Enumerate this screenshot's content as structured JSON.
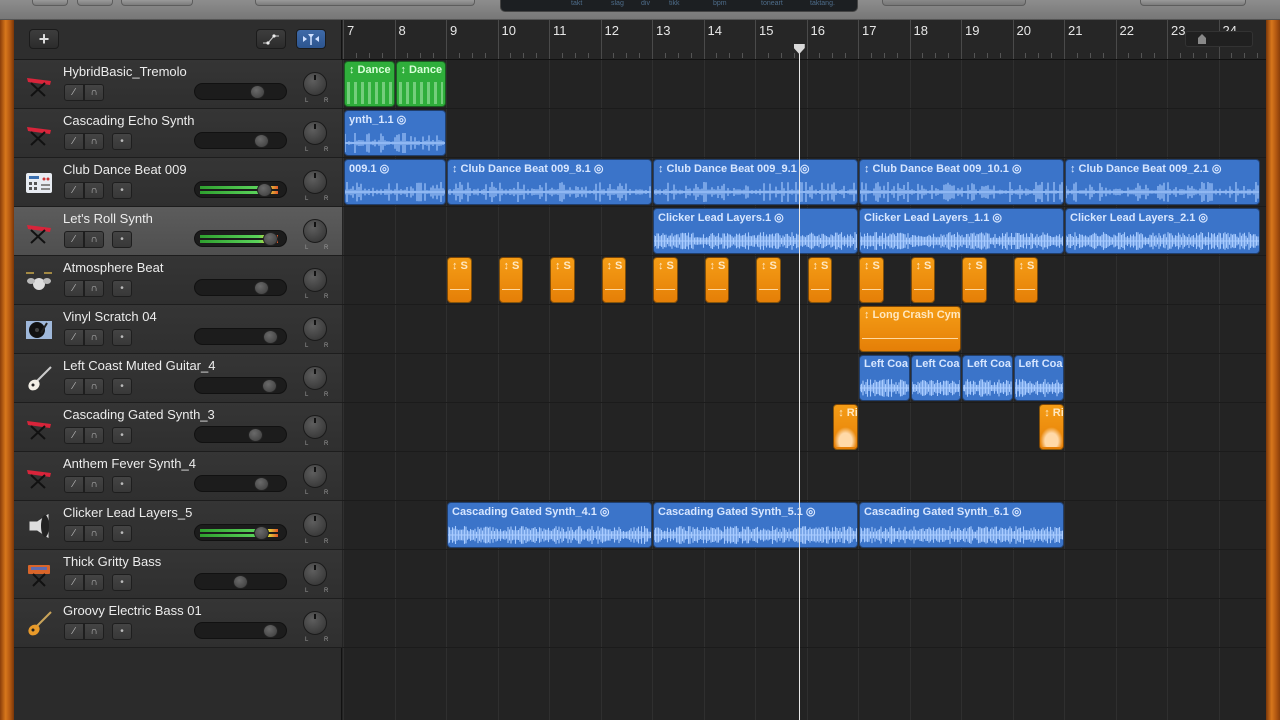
{
  "lcd": {
    "labels": [
      "takt",
      "slag",
      "div",
      "tikk",
      "bpm",
      "toneart",
      "taktang."
    ]
  },
  "header": {
    "add_track_label": "+",
    "smart_controls_icon": "automation-icon",
    "filter_icon": "catch-playhead-icon"
  },
  "ruler": {
    "bars": [
      7,
      8,
      9,
      10,
      11,
      12,
      13,
      14,
      15,
      16,
      17,
      18,
      19,
      20,
      21,
      22,
      23,
      24
    ],
    "first_bar": 7,
    "playhead_bar": 15.85
  },
  "tracks": [
    {
      "name": "HybridBasic_Tremolo",
      "icon": "keyboard-synth",
      "volume": 0.72,
      "metering": false,
      "selected": false,
      "has_record": false
    },
    {
      "name": "Cascading Echo Synth",
      "icon": "keyboard-synth",
      "volume": 0.78,
      "metering": false,
      "selected": false,
      "has_record": true
    },
    {
      "name": "Club Dance Beat 009",
      "icon": "drum-machine",
      "volume": 0.82,
      "metering": true,
      "selected": false,
      "has_record": true
    },
    {
      "name": "Let's Roll Synth",
      "icon": "keyboard-synth",
      "volume": 0.9,
      "metering": true,
      "selected": true,
      "has_record": true
    },
    {
      "name": "Atmosphere Beat",
      "icon": "drum-kit",
      "volume": 0.77,
      "metering": false,
      "selected": false,
      "has_record": true
    },
    {
      "name": "Vinyl Scratch 04",
      "icon": "turntable",
      "volume": 0.9,
      "metering": false,
      "selected": false,
      "has_record": true
    },
    {
      "name": "Left Coast Muted Guitar_4",
      "icon": "electric-guitar",
      "volume": 0.88,
      "metering": false,
      "selected": false,
      "has_record": true
    },
    {
      "name": "Cascading Gated Synth_3",
      "icon": "keyboard-synth",
      "volume": 0.7,
      "metering": false,
      "selected": false,
      "has_record": true
    },
    {
      "name": "Anthem Fever Synth_4",
      "icon": "keyboard-synth",
      "volume": 0.77,
      "metering": false,
      "selected": false,
      "has_record": true
    },
    {
      "name": "Clicker Lead Layers_5",
      "icon": "speaker",
      "volume": 0.78,
      "metering": true,
      "selected": false,
      "has_record": true
    },
    {
      "name": "Thick Gritty Bass",
      "icon": "bass-synth",
      "volume": 0.5,
      "metering": false,
      "selected": false,
      "has_record": true
    },
    {
      "name": "Groovy Electric Bass 01",
      "icon": "bass-guitar",
      "volume": 0.9,
      "metering": false,
      "selected": false,
      "has_record": true
    }
  ],
  "pan_labels": {
    "left": "L",
    "right": "R"
  },
  "regions": [
    {
      "track": 0,
      "type": "midi",
      "label": "Dance",
      "start": 7,
      "end": 8,
      "loop": true
    },
    {
      "track": 0,
      "type": "midi",
      "label": "Dance",
      "start": 8,
      "end": 9,
      "loop": true
    },
    {
      "track": 1,
      "type": "audio",
      "label": "ynth_1.1",
      "start": 7,
      "end": 9,
      "link": true
    },
    {
      "track": 2,
      "type": "audio",
      "label": "009.1",
      "start": 7,
      "end": 9,
      "link": true
    },
    {
      "track": 2,
      "type": "audio",
      "label": "Club Dance Beat 009_8.1",
      "start": 9,
      "end": 13,
      "link": true,
      "loop": true
    },
    {
      "track": 2,
      "type": "audio",
      "label": "Club Dance Beat 009_9.1",
      "start": 13,
      "end": 17,
      "link": true,
      "loop": true
    },
    {
      "track": 2,
      "type": "audio",
      "label": "Club Dance Beat 009_10.1",
      "start": 17,
      "end": 21,
      "link": true,
      "loop": true
    },
    {
      "track": 2,
      "type": "audio",
      "label": "Club Dance Beat 009_2.1",
      "start": 21,
      "end": 24.8,
      "link": true,
      "loop": true
    },
    {
      "track": 3,
      "type": "audio",
      "label": "Clicker Lead Layers.1",
      "start": 13,
      "end": 17,
      "link": true
    },
    {
      "track": 3,
      "type": "audio",
      "label": "Clicker Lead Layers_1.1",
      "start": 17,
      "end": 21,
      "link": true
    },
    {
      "track": 3,
      "type": "audio",
      "label": "Clicker Lead Layers_2.1",
      "start": 21,
      "end": 24.8,
      "link": true
    },
    {
      "track": 4,
      "type": "drum",
      "label": "S",
      "start": 9,
      "end": 9.5,
      "loop": true
    },
    {
      "track": 4,
      "type": "drum",
      "label": "S",
      "start": 10,
      "end": 10.5,
      "loop": true
    },
    {
      "track": 4,
      "type": "drum",
      "label": "S",
      "start": 11,
      "end": 11.5,
      "loop": true
    },
    {
      "track": 4,
      "type": "drum",
      "label": "S",
      "start": 12,
      "end": 12.5,
      "loop": true
    },
    {
      "track": 4,
      "type": "drum",
      "label": "S",
      "start": 13,
      "end": 13.5,
      "loop": true
    },
    {
      "track": 4,
      "type": "drum",
      "label": "S",
      "start": 14,
      "end": 14.5,
      "loop": true
    },
    {
      "track": 4,
      "type": "drum",
      "label": "S",
      "start": 15,
      "end": 15.5,
      "loop": true
    },
    {
      "track": 4,
      "type": "drum",
      "label": "S",
      "start": 16,
      "end": 16.5,
      "loop": true
    },
    {
      "track": 4,
      "type": "drum",
      "label": "S",
      "start": 17,
      "end": 17.5,
      "loop": true
    },
    {
      "track": 4,
      "type": "drum",
      "label": "S",
      "start": 18,
      "end": 18.5,
      "loop": true
    },
    {
      "track": 4,
      "type": "drum",
      "label": "S",
      "start": 19,
      "end": 19.5,
      "loop": true
    },
    {
      "track": 4,
      "type": "drum",
      "label": "S",
      "start": 20,
      "end": 20.5,
      "loop": true
    },
    {
      "track": 5,
      "type": "drum",
      "label": "Long Crash Cym",
      "start": 17,
      "end": 19,
      "loop": true
    },
    {
      "track": 6,
      "type": "audio",
      "label": "Left Coa",
      "start": 17,
      "end": 18
    },
    {
      "track": 6,
      "type": "audio",
      "label": "Left Coa",
      "start": 18,
      "end": 19
    },
    {
      "track": 6,
      "type": "audio",
      "label": "Left Coa",
      "start": 19,
      "end": 20
    },
    {
      "track": 6,
      "type": "audio",
      "label": "Left Coa",
      "start": 20,
      "end": 21
    },
    {
      "track": 7,
      "type": "drum",
      "label": "Ri",
      "start": 16.5,
      "end": 17,
      "loop": true,
      "wave": true
    },
    {
      "track": 7,
      "type": "drum",
      "label": "Ri",
      "start": 20.5,
      "end": 21,
      "loop": true,
      "wave": true
    },
    {
      "track": 9,
      "type": "audio",
      "label": "Cascading Gated Synth_4.1",
      "start": 9,
      "end": 13,
      "link": true
    },
    {
      "track": 9,
      "type": "audio",
      "label": "Cascading Gated Synth_5.1",
      "start": 13,
      "end": 17,
      "link": true
    },
    {
      "track": 9,
      "type": "audio",
      "label": "Cascading Gated Synth_6.1",
      "start": 17,
      "end": 21,
      "link": true
    }
  ],
  "colors": {
    "audio_region": "#3b74c9",
    "midi_region": "#2fae3b",
    "drum_region": "#f29414",
    "selected_track": "#555555"
  }
}
